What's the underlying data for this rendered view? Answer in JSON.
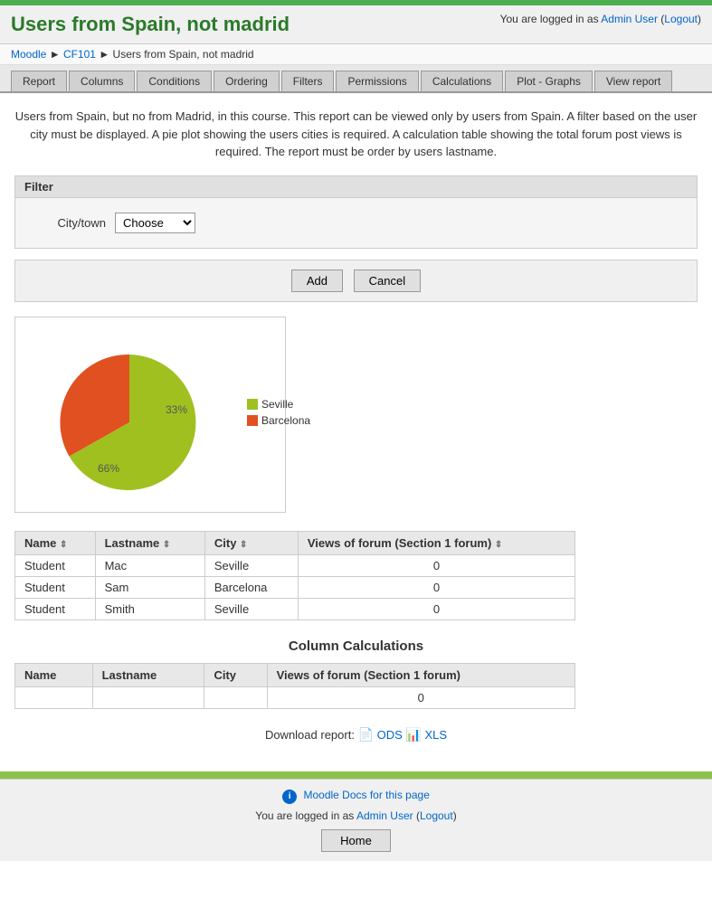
{
  "topbar": {
    "color": "#4CAF50"
  },
  "header": {
    "title": "Users from Spain, not madrid",
    "login_text": "You are logged in as",
    "user": "Admin User",
    "logout": "Logout"
  },
  "breadcrumb": {
    "moodle": "Moodle",
    "sep1": "►",
    "cf101": "CF101",
    "sep2": "►",
    "current": "Users from Spain, not madrid"
  },
  "nav": {
    "tabs": [
      {
        "label": "Report",
        "active": false
      },
      {
        "label": "Columns",
        "active": false
      },
      {
        "label": "Conditions",
        "active": false
      },
      {
        "label": "Ordering",
        "active": false
      },
      {
        "label": "Filters",
        "active": false
      },
      {
        "label": "Permissions",
        "active": false
      },
      {
        "label": "Calculations",
        "active": false
      },
      {
        "label": "Plot - Graphs",
        "active": false
      },
      {
        "label": "View report",
        "active": false
      }
    ]
  },
  "description": "Users from Spain, but no from Madrid, in this course. This report can be viewed only by users from Spain. A filter based on the user city must be displayed. A pie plot showing the users cities is required. A calculation table showing the total forum post views is required. The report must be order by users lastname.",
  "filter": {
    "title": "Filter",
    "label": "City/town",
    "select_default": "Choose",
    "options": [
      "Choose",
      "Seville",
      "Barcelona"
    ]
  },
  "buttons": {
    "add": "Add",
    "cancel": "Cancel"
  },
  "chart": {
    "seville_pct": 66,
    "barcelona_pct": 33,
    "seville_label": "66%",
    "barcelona_label": "33%",
    "legend": [
      {
        "label": "Seville",
        "color": "#a0c020"
      },
      {
        "label": "Barcelona",
        "color": "#e05020"
      }
    ]
  },
  "table": {
    "headers": [
      "Name",
      "Lastname",
      "City",
      "Views of forum (Section 1 forum)"
    ],
    "rows": [
      [
        "Student",
        "Mac",
        "Seville",
        "0"
      ],
      [
        "Student",
        "Sam",
        "Barcelona",
        "0"
      ],
      [
        "Student",
        "Smith",
        "Seville",
        "0"
      ]
    ]
  },
  "calculations": {
    "title": "Column Calculations",
    "headers": [
      "Name",
      "Lastname",
      "City",
      "Views of forum (Section 1 forum)"
    ],
    "rows": [
      [
        "",
        "",
        "",
        "0"
      ]
    ]
  },
  "download": {
    "text": "Download report:",
    "ods_label": "ODS",
    "xls_label": "XLS"
  },
  "footer": {
    "docs_text": "Moodle Docs for this page",
    "login_text": "You are logged in as",
    "user": "Admin User",
    "logout": "Logout",
    "home_btn": "Home"
  }
}
